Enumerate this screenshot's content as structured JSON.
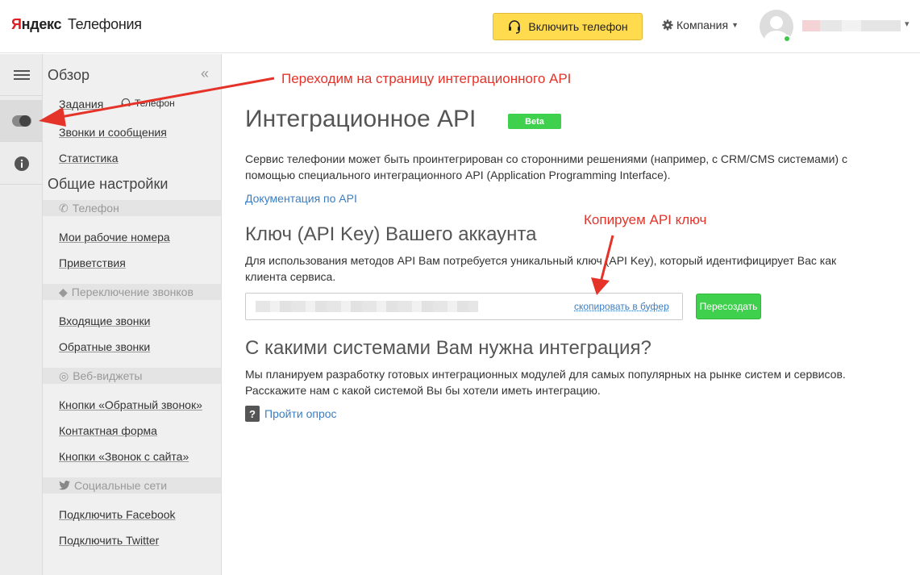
{
  "header": {
    "logo_brand_first": "Я",
    "logo_brand_rest": "ндекс",
    "logo_product": "Телефония",
    "enable_phone_label": "Включить телефон",
    "company_label": "Компания"
  },
  "sidebar": {
    "title": "Обзор",
    "tasks": "Задания",
    "phone_tag": "Телефон",
    "calls_messages": "Звонки и сообщения",
    "statistics": "Статистика",
    "general_settings": "Общие настройки",
    "group_phone": "Телефон",
    "my_numbers": "Мои рабочие номера",
    "greetings": "Приветствия",
    "group_switch": "Переключение звонков",
    "incoming": "Входящие звонки",
    "callbacks": "Обратные звонки",
    "group_widgets": "Веб-виджеты",
    "callback_buttons": "Кнопки «Обратный звонок»",
    "contact_form": "Контактная форма",
    "site_call_buttons": "Кнопки «Звонок с сайта»",
    "group_social": "Социальные сети",
    "connect_facebook": "Подключить Facebook",
    "connect_twitter": "Подключить Twitter"
  },
  "main": {
    "title": "Интеграционное API",
    "beta_badge": "Beta",
    "intro_line1": "Сервис телефонии может быть проинтегрирован со сторонними решениями (например, с CRM/CMS системами) с",
    "intro_line2": "помощью специального интеграционного API (Application Programming Interface).",
    "docs_link": "Документация по API",
    "api_key_heading": "Ключ (API Key) Вашего аккаунта",
    "api_key_desc_line1": "Для использования методов API Вам потребуется уникальный ключ (API Key), который идентифицирует Вас как",
    "api_key_desc_line2": "клиента сервиса.",
    "copy_link": "скопировать в буфер",
    "regenerate_button": "Пересоздать",
    "integration_heading": "С какими системами Вам нужна интеграция?",
    "integration_desc_line1": "Мы планируем разработку готовых интеграционных модулей для самых популярных на рынке систем и сервисов.",
    "integration_desc_line2": "Расскажите нам с какой системой Вы бы хотели иметь интеграцию.",
    "survey_link": "Пройти опрос"
  },
  "annotations": {
    "go_to_api": "Переходим на страницу интеграционного API",
    "copy_key": "Копируем API ключ"
  },
  "colors": {
    "accent_yellow": "#ffdb4d",
    "green": "#3fd14d",
    "link_blue": "#3a7ec2",
    "annotation_red": "#e5332a"
  }
}
